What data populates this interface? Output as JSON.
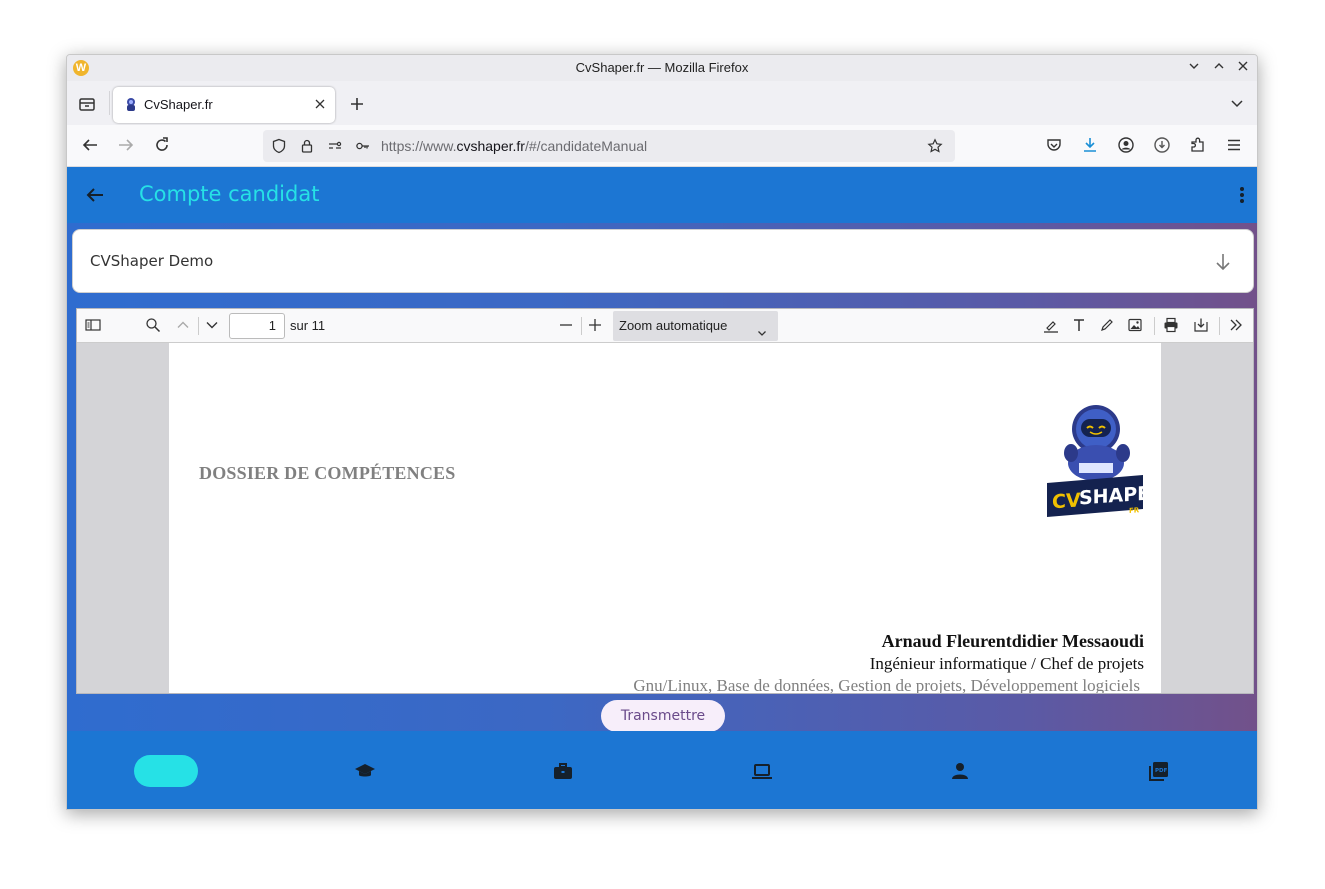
{
  "window": {
    "title": "CvShaper.fr — Mozilla Firefox",
    "app_icon": "W"
  },
  "tabs": [
    {
      "label": "CvShaper.fr",
      "icon": "astronaut-favicon"
    }
  ],
  "address_bar": {
    "url_prefix": "https://www.",
    "url_domain": "cvshaper.fr",
    "url_path": "/#/candidateManual"
  },
  "app": {
    "header_title": "Compte candidat",
    "selector_value": "CVShaper Demo",
    "accent_color": "#26e1e6",
    "primary_color": "#1c76d3"
  },
  "pdf_viewer": {
    "page_number": "1",
    "page_total": "sur 11",
    "zoom_label": "Zoom automatique",
    "document": {
      "title": "DOSSIER DE COMPÉTENCES",
      "logo_text": "CVSHAPER",
      "logo_suffix": "FR",
      "candidate_name": "Arnaud Fleurentdidier Messaoudi",
      "candidate_role": "Ingénieur informatique / Chef de projets",
      "candidate_skills": "Gnu/Linux, Base de données, Gestion de projets, Développement logiciels"
    }
  },
  "actions": {
    "submit_label": "Transmettre"
  },
  "bottom_nav": [
    {
      "icon": "home-icon",
      "active": true
    },
    {
      "icon": "school-icon",
      "active": false
    },
    {
      "icon": "briefcase-icon",
      "active": false
    },
    {
      "icon": "laptop-icon",
      "active": false
    },
    {
      "icon": "person-icon",
      "active": false
    },
    {
      "icon": "pdf-icon",
      "active": false
    }
  ]
}
